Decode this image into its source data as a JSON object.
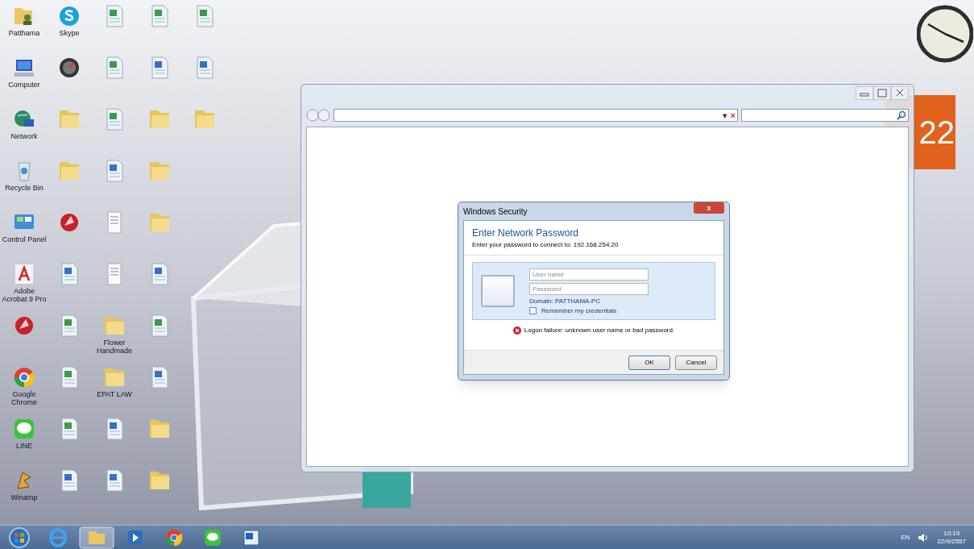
{
  "desktop": {
    "icon_columns": [
      [
        {
          "kind": "user-folder",
          "label": "Patthama"
        },
        {
          "kind": "computer",
          "label": "Computer"
        },
        {
          "kind": "network",
          "label": "Network"
        },
        {
          "kind": "recycle-bin",
          "label": "Recycle Bin"
        },
        {
          "kind": "control-panel",
          "label": "Control Panel"
        },
        {
          "kind": "acrobat",
          "label": "Adobe Acrobat 9 Pro"
        },
        {
          "kind": "red-app"
        },
        {
          "kind": "chrome",
          "label": "Google Chrome"
        },
        {
          "kind": "line",
          "label": "LINE"
        },
        {
          "kind": "winamp",
          "label": "Winamp"
        }
      ],
      [
        {
          "kind": "skype",
          "label": "Skype"
        },
        {
          "kind": "gauge"
        },
        {
          "kind": "folder"
        },
        {
          "kind": "folder"
        },
        {
          "kind": "red-app"
        },
        {
          "kind": "word"
        },
        {
          "kind": "excel"
        },
        {
          "kind": "excel"
        },
        {
          "kind": "excel"
        },
        {
          "kind": "word"
        }
      ],
      [
        {
          "kind": "excel"
        },
        {
          "kind": "excel"
        },
        {
          "kind": "excel"
        },
        {
          "kind": "word"
        },
        {
          "kind": "document"
        },
        {
          "kind": "document"
        },
        {
          "kind": "folder",
          "label": "Flower Handmade"
        },
        {
          "kind": "folder",
          "label": "EPAT LAW"
        },
        {
          "kind": "word"
        },
        {
          "kind": "word"
        }
      ],
      [
        {
          "kind": "excel"
        },
        {
          "kind": "word"
        },
        {
          "kind": "folder"
        },
        {
          "kind": "folder"
        },
        {
          "kind": "folder"
        },
        {
          "kind": "word"
        },
        {
          "kind": "excel"
        },
        {
          "kind": "word"
        },
        {
          "kind": "folder"
        },
        {
          "kind": "folder"
        }
      ],
      [
        {
          "kind": "excel"
        },
        {
          "kind": "word"
        },
        {
          "kind": "folder"
        }
      ]
    ]
  },
  "calendar_gadget": {
    "day": "22"
  },
  "browser_window": {
    "controls": [
      "▾",
      "×"
    ]
  },
  "dialog": {
    "title": "Windows Security",
    "close": "x",
    "heading": "Enter Network Password",
    "subtitle": "Enter your password to connect to: 192.168.254.20",
    "username": {
      "placeholder": "User name"
    },
    "password": {
      "placeholder": "Password"
    },
    "domain": "Domain: PATTHAMA-PC",
    "remember": {
      "label": "Remember my credentials",
      "checked": false
    },
    "error": "Logon failure: unknown user name or bad password.",
    "buttons": [
      {
        "label": "OK",
        "default": true
      },
      {
        "label": "Cancel",
        "default": false
      }
    ]
  },
  "taskbar": {
    "apps": [
      {
        "kind": "start"
      },
      {
        "kind": "ie"
      },
      {
        "kind": "explorer",
        "selected": true
      },
      {
        "kind": "media",
        "selected": false
      },
      {
        "kind": "chrome",
        "selected": false
      },
      {
        "kind": "line",
        "selected": false
      },
      {
        "kind": "word",
        "selected": false
      }
    ],
    "language": "EN",
    "time": "10:19",
    "date": "22/9/2557"
  }
}
